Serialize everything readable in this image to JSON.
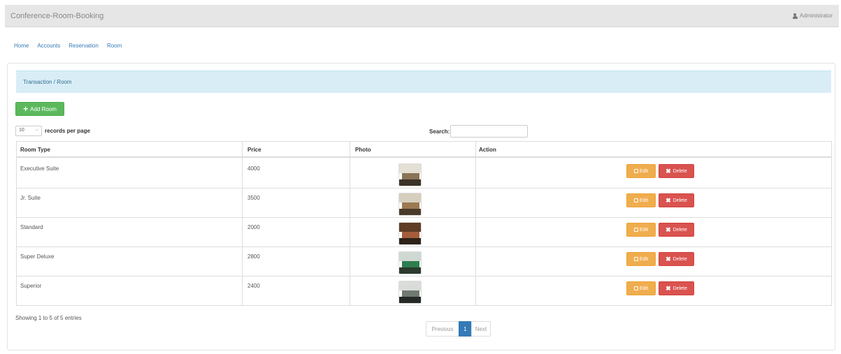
{
  "app": {
    "title": "Conference-Room-Booking",
    "user": "Administrator"
  },
  "nav": [
    "Home",
    "Accounts",
    "Reservation",
    "Room"
  ],
  "breadcrumb": "Transaction / Room",
  "add_button": "Add Room",
  "length": {
    "value": "10",
    "label": "records per page"
  },
  "search": {
    "label": "Search:"
  },
  "table": {
    "columns": [
      "Room Type",
      "Price",
      "Photo",
      "Action"
    ],
    "rows": [
      {
        "room_type": "Executive Suite",
        "price": "4000",
        "photo_colors": [
          "#e4e0d4",
          "#8a7458",
          "#3c3328"
        ]
      },
      {
        "room_type": "Jr. Suite",
        "price": "3500",
        "photo_colors": [
          "#d7cfbd",
          "#9c7a52",
          "#4a3a2a"
        ]
      },
      {
        "room_type": "Standard",
        "price": "2000",
        "photo_colors": [
          "#5e3c26",
          "#a45c3c",
          "#2e2218"
        ]
      },
      {
        "room_type": "Super Deluxe",
        "price": "2800",
        "photo_colors": [
          "#cfd8d2",
          "#2e7d4e",
          "#2a3a2c"
        ]
      },
      {
        "room_type": "Superior",
        "price": "2400",
        "photo_colors": [
          "#d9dcd8",
          "#707a70",
          "#262a26"
        ]
      }
    ],
    "edit_label": "Edit",
    "delete_label": "Delete"
  },
  "footer": {
    "info": "Showing 1 to 5 of 5 entries",
    "pagination": {
      "previous": "Previous",
      "current": "1",
      "next": "Next"
    }
  },
  "colors": {
    "add": "#5cb85c",
    "edit": "#f0ad4e",
    "delete": "#d9534f",
    "heading_bg": "#d9edf7",
    "active_page": "#337ab7"
  }
}
